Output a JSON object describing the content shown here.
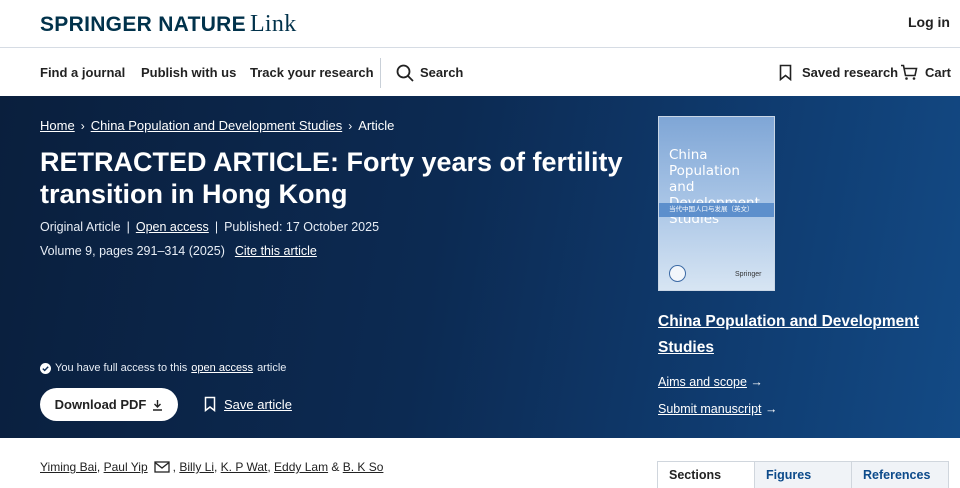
{
  "header": {
    "brand_primary": "SPRINGER NATURE",
    "brand_secondary": "Link",
    "login_label": "Log in"
  },
  "nav": {
    "find_journal": "Find a journal",
    "publish": "Publish with us",
    "track": "Track your research",
    "search": "Search",
    "saved_research": "Saved research",
    "cart": "Cart"
  },
  "breadcrumb": {
    "home": "Home",
    "journal": "China Population and Development Studies",
    "current": "Article"
  },
  "article": {
    "title": "RETRACTED ARTICLE: Forty years of fertility transition in Hong Kong",
    "type": "Original Article",
    "open_access": "Open access",
    "published": "Published: 17 October 2025",
    "volume": "Volume 9, pages 291–314 (2025)",
    "cite": "Cite this article",
    "access_prefix": "You have full access to this",
    "access_link": "open access",
    "access_suffix": "article",
    "download_label": "Download PDF",
    "save_label": "Save article"
  },
  "journal": {
    "cover_title": "China Population and Development Studies",
    "cover_subtitle": "当代中国人口与发展（英文）",
    "cover_publisher": "Springer",
    "name": "China Population and Development Studies",
    "aims": "Aims and scope",
    "submit": "Submit manuscript"
  },
  "authors": {
    "a1": "Yiming Bai",
    "a2": "Paul Yip",
    "a3": "Billy Li",
    "a4": "K. P Wat",
    "a5": "Eddy Lam",
    "a6": "B. K So"
  },
  "tabs": [
    "Sections",
    "Figures",
    "References"
  ],
  "colors": {
    "brand": "#01324b",
    "hero_dark": "#0a1f3d",
    "hero_light": "#134a85"
  }
}
